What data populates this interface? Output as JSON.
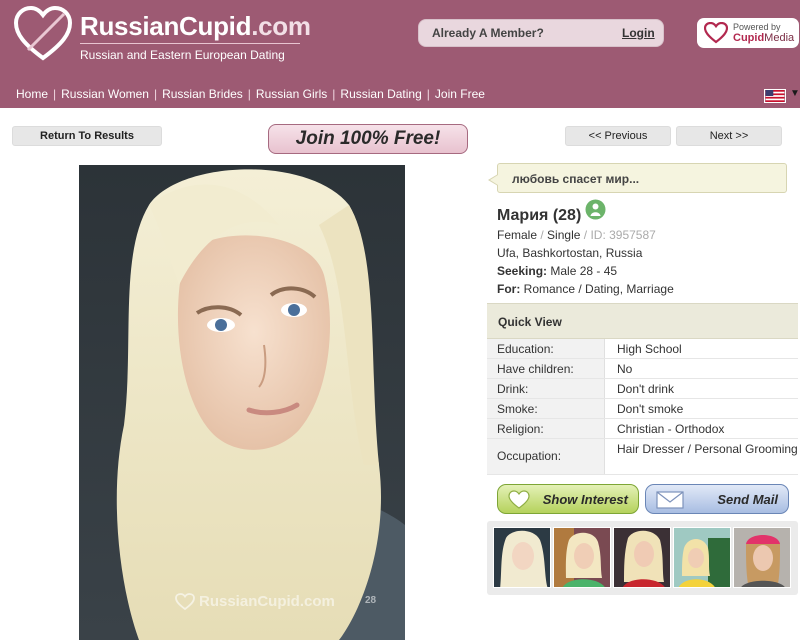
{
  "brand": {
    "name_part1": "RussianCupid",
    "name_part2": ".com",
    "tagline": "Russian and Eastern European Dating",
    "watermark": "RussianCupid.com",
    "watermark_age": "28"
  },
  "header": {
    "member_prompt": "Already A Member?",
    "login_label": "Login",
    "powered_by_label": "Powered by",
    "powered_by_brand_1": "Cupid",
    "powered_by_brand_2": "Media"
  },
  "nav": {
    "items": [
      {
        "label": "Home"
      },
      {
        "label": "Russian Women"
      },
      {
        "label": "Russian Brides"
      },
      {
        "label": "Russian Girls"
      },
      {
        "label": "Russian Dating"
      },
      {
        "label": "Join Free"
      }
    ],
    "separator": "|",
    "language": "us-flag-icon"
  },
  "toolbar": {
    "return_label": "Return To Results",
    "join_label": "Join 100% Free!",
    "prev_label": "<< Previous",
    "next_label": "Next >>"
  },
  "profile": {
    "headline": "любовь спасет мир...",
    "name_age": "Мария (28)",
    "gender": "Female",
    "status": "Single",
    "id_label": "ID: 3957587",
    "location": "Ufa, Bashkortostan, Russia",
    "seeking_label": "Seeking:",
    "seeking_value": "Male 28 - 45",
    "for_label": "For:",
    "for_value": "Romance / Dating, Marriage",
    "online_icon": "person-online-icon"
  },
  "quick_view": {
    "title": "Quick View",
    "rows": [
      {
        "key": "Education:",
        "value": "High School"
      },
      {
        "key": "Have children:",
        "value": "No"
      },
      {
        "key": "Drink:",
        "value": "Don't drink"
      },
      {
        "key": "Smoke:",
        "value": "Don't smoke"
      },
      {
        "key": "Religion:",
        "value": "Christian - Orthodox"
      },
      {
        "key": "Occupation:",
        "value": "Hair Dresser / Personal Grooming"
      }
    ]
  },
  "actions": {
    "interest_label": "Show Interest",
    "mail_label": "Send Mail",
    "interest_icon": "heart-icon",
    "mail_icon": "envelope-icon"
  },
  "colors": {
    "header_bg": "#9d5a73",
    "quote_bg": "#f5f4df",
    "quickview_bg": "#ebeadb",
    "interest_green": "#b5d25c",
    "mail_blue": "#a8bde2"
  }
}
